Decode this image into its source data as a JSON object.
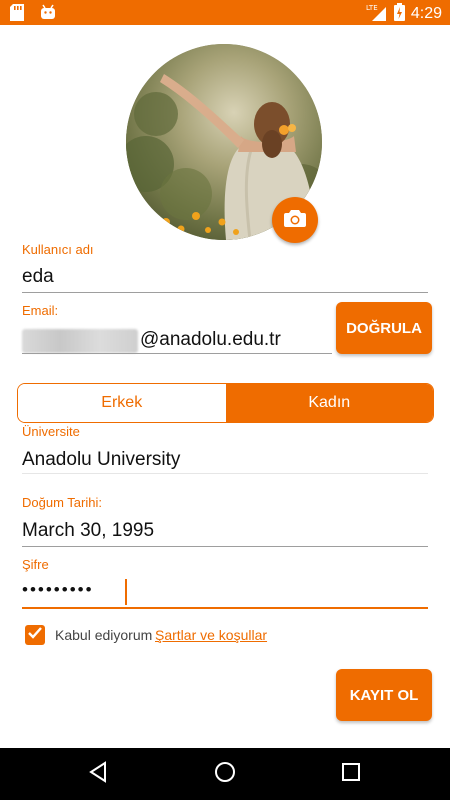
{
  "status_bar": {
    "time": "4:29",
    "network": "LTE",
    "icons": [
      "sd-card-icon",
      "android-icon",
      "signal-icon",
      "battery-charging-icon"
    ]
  },
  "profile": {
    "photo_alt": "profile-photo",
    "camera_icon": "camera-icon"
  },
  "form": {
    "username": {
      "label": "Kullanıcı adı",
      "value": "eda"
    },
    "email": {
      "label": "Email:",
      "domain": "@anadolu.edu.tr",
      "verify_label": "DOĞRULA"
    },
    "gender": {
      "options": [
        "Erkek",
        "Kadın"
      ],
      "selected": "Kadın"
    },
    "university": {
      "label": "Üniversite",
      "value": "Anadolu University"
    },
    "birthdate": {
      "label": "Doğum Tarihi:",
      "value": "March 30, 1995"
    },
    "password": {
      "label": "Şifre",
      "value": "•••••••••"
    },
    "terms": {
      "checked": true,
      "accept_text": "Kabul ediyorum",
      "link_text": "Şartlar ve koşullar"
    },
    "register_label": "KAYIT OL"
  },
  "nav": {
    "back_icon": "back-icon",
    "home_icon": "home-icon",
    "recents_icon": "recents-icon"
  },
  "colors": {
    "accent": "#EF6C00"
  }
}
